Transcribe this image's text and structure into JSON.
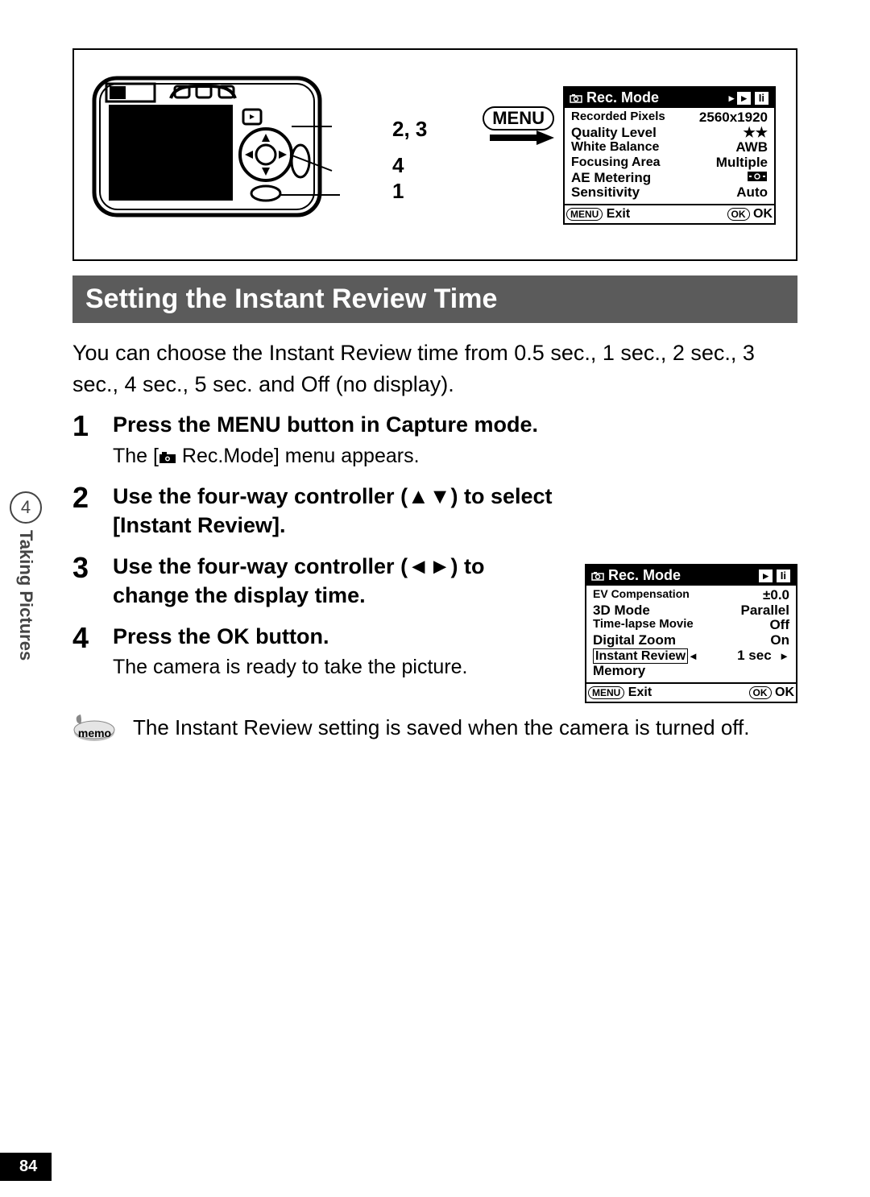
{
  "diagram": {
    "labels": {
      "l23": "2, 3",
      "l4": "4",
      "l1": "1"
    },
    "menu_btn": "MENU"
  },
  "recmode1": {
    "title": "Rec. Mode",
    "rows": [
      {
        "label": "Recorded Pixels",
        "value": "2560x1920"
      },
      {
        "label": "Quality Level",
        "value": "★★"
      },
      {
        "label": "White Balance",
        "value": "AWB"
      },
      {
        "label": "Focusing Area",
        "value": "Multiple"
      },
      {
        "label": "AE  Metering",
        "value": "⦿"
      },
      {
        "label": "Sensitivity",
        "value": "Auto"
      }
    ],
    "footer": {
      "menu": "MENU",
      "exit": "Exit",
      "ok_pill": "OK",
      "ok": "OK"
    }
  },
  "section_title": "Setting the Instant Review Time",
  "intro": "You can choose the Instant Review time from 0.5 sec., 1 sec., 2 sec., 3 sec., 4 sec., 5 sec. and Off (no display).",
  "steps": {
    "s1": {
      "num": "1",
      "head": "Press the MENU button in Capture mode.",
      "sub_pre": "The [",
      "sub_post": " Rec.Mode] menu appears."
    },
    "s2": {
      "num": "2",
      "head": "Use the four-way controller (▲▼) to select [Instant Review]."
    },
    "s3": {
      "num": "3",
      "head": "Use the four-way controller (◄►) to change the display time."
    },
    "s4": {
      "num": "4",
      "head": "Press the OK button.",
      "sub": "The camera is ready to take the picture."
    }
  },
  "recmode2": {
    "title": "Rec. Mode",
    "rows": [
      {
        "label": "EV Compensation",
        "value": "±0.0"
      },
      {
        "label": "3D Mode",
        "value": "Parallel"
      },
      {
        "label": "Time-lapse Movie",
        "value": "Off"
      },
      {
        "label": "Digital Zoom",
        "value": "On"
      },
      {
        "label": "Instant Review",
        "value": "1 sec",
        "highlight": true
      },
      {
        "label": "Memory",
        "value": ""
      }
    ],
    "footer": {
      "menu": "MENU",
      "exit": "Exit",
      "ok_pill": "OK",
      "ok": "OK"
    }
  },
  "memo": {
    "label": "memo",
    "text": "The Instant Review setting is saved when the camera is turned off."
  },
  "side": {
    "chapter": "4",
    "label": "Taking Pictures"
  },
  "page_number": "84"
}
